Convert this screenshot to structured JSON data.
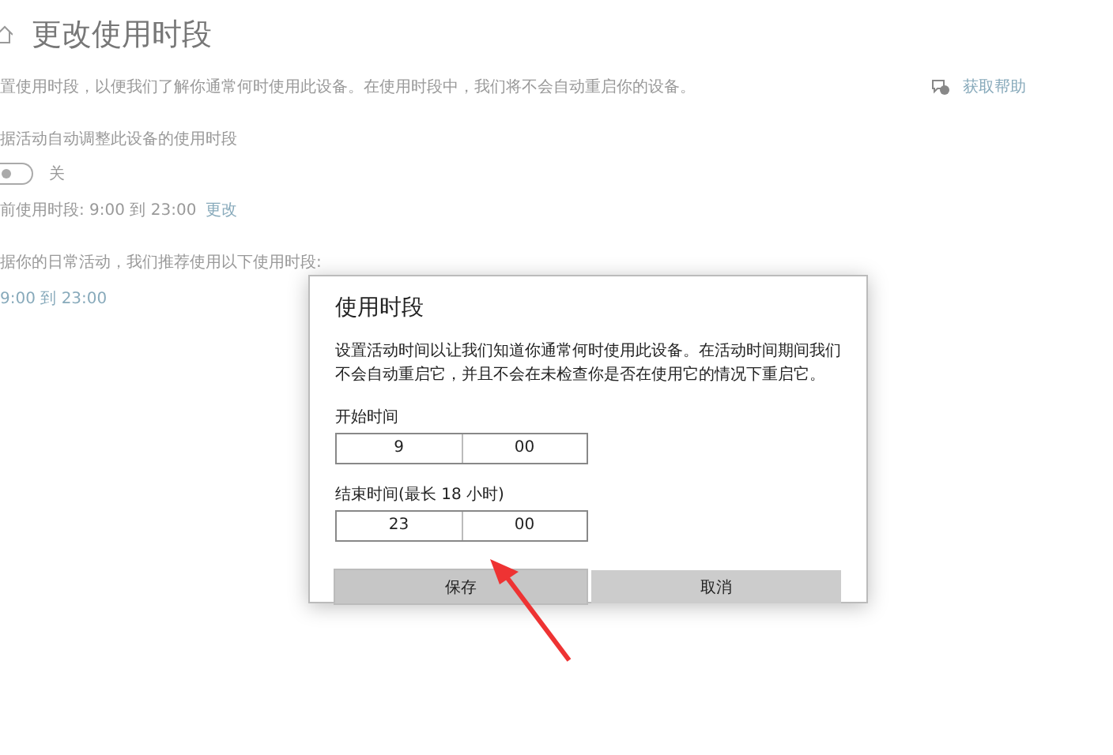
{
  "page": {
    "title": "更改使用时段",
    "description": "置使用时段，以便我们了解你通常何时使用此设备。在使用时段中，我们将不会自动重启你的设备。",
    "help_link": "获取帮助",
    "auto_adjust_label": "据活动自动调整此设备的使用时段",
    "toggle": {
      "on": false,
      "label": "关"
    },
    "current_label": "前使用时段: 9:00 到 23:00",
    "change_link": "更改",
    "recommend_label": "据你的日常活动，我们推荐使用以下使用时段:",
    "recommended": "9:00 到 23:00"
  },
  "dialog": {
    "title": "使用时段",
    "description": "设置活动时间以让我们知道你通常何时使用此设备。在活动时间期间我们不会自动重启它，并且不会在未检查你是否在使用它的情况下重启它。",
    "fields": [
      {
        "label": "开始时间",
        "hour": "9",
        "minute": "00"
      },
      {
        "label": "结束时间(最长 18 小时)",
        "hour": "23",
        "minute": "00"
      }
    ],
    "buttons": [
      {
        "label": "保存",
        "selected": true
      },
      {
        "label": "取消",
        "selected": false
      }
    ]
  }
}
